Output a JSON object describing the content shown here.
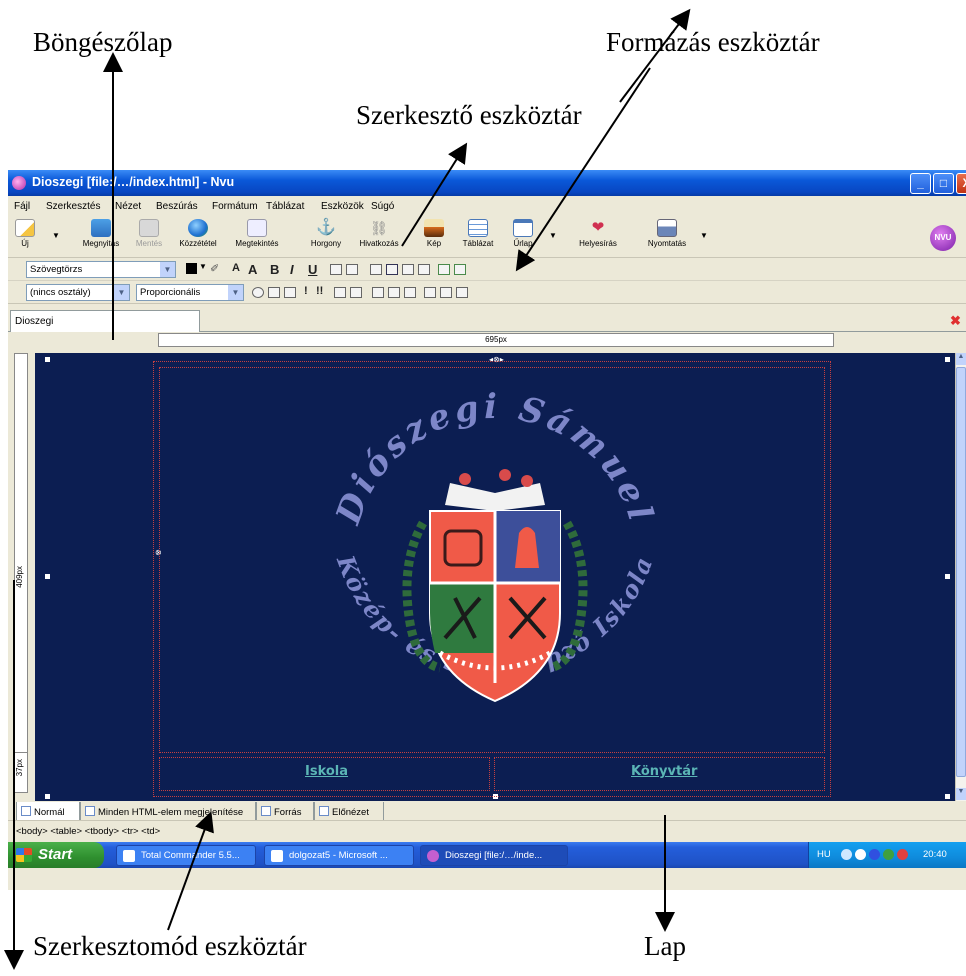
{
  "captions": {
    "tab_browser": "Böngészőlap",
    "formatting_toolbar": "Formázás eszköztár",
    "editing_toolbar": "Szerkesztő eszköztár",
    "edit_mode_toolbar": "Szerkesztomód eszköztár",
    "page": "Lap"
  },
  "window": {
    "title": "Dioszegi [file:/…/index.html] - Nvu",
    "minimize": "_",
    "maximize": "□",
    "close": "X"
  },
  "menu": [
    "Fájl",
    "Szerkesztés",
    "Nézet",
    "Beszúrás",
    "Formátum",
    "Táblázat",
    "Eszközök",
    "Súgó"
  ],
  "toolbar": {
    "buttons": [
      {
        "label": "Új",
        "icon": "new-file-icon"
      },
      {
        "label": "Megnyitás",
        "icon": "open-icon"
      },
      {
        "label": "Mentés",
        "icon": "save-icon",
        "disabled": true
      },
      {
        "label": "Közzététel",
        "icon": "publish-globe-icon"
      },
      {
        "label": "Megtekintés",
        "icon": "browse-icon"
      },
      {
        "label": "Horgony",
        "icon": "anchor-icon"
      },
      {
        "label": "Hivatkozás",
        "icon": "link-icon"
      },
      {
        "label": "Kép",
        "icon": "image-icon"
      },
      {
        "label": "Táblázat",
        "icon": "table-icon"
      },
      {
        "label": "Űrlap",
        "icon": "form-icon"
      },
      {
        "label": "Helyesírás",
        "icon": "spellcheck-icon"
      },
      {
        "label": "Nyomtatás",
        "icon": "print-icon"
      }
    ],
    "logo": "NVU"
  },
  "format_bar": {
    "paragraph_style": "Szövegtörzs",
    "class_select": "(nincs osztály)",
    "font_select": "Proporcionális",
    "bold": "B",
    "italic": "I",
    "underline": "U",
    "smaller": "A",
    "larger": "A"
  },
  "tabs": {
    "document": "Dioszegi"
  },
  "rulers": {
    "width_label": "695px",
    "height_label_1": "409px",
    "height_label_2": "37px"
  },
  "page_content": {
    "crest_top_text": "Diószegi Sámuel",
    "crest_bottom_text": "Közép- és Szakképző Iskola",
    "links": [
      "Iskola",
      "Könyvtár"
    ]
  },
  "edit_modes": [
    "Normál",
    "Minden HTML-elem megjelenítése",
    "Forrás",
    "Előnézet"
  ],
  "statusbar": "<body> <table> <tbody> <tr> <td>",
  "taskbar": {
    "start": "Start",
    "tasks": [
      "Total Commander 5.5...",
      "dolgozat5 - Microsoft ...",
      "Dioszegi [file:/…/inde..."
    ],
    "lang": "HU",
    "time": "20:40"
  },
  "colors": {
    "page_bg": "#0c1e52",
    "titlebar": "#0a58d8",
    "link": "#5bb5b5"
  }
}
